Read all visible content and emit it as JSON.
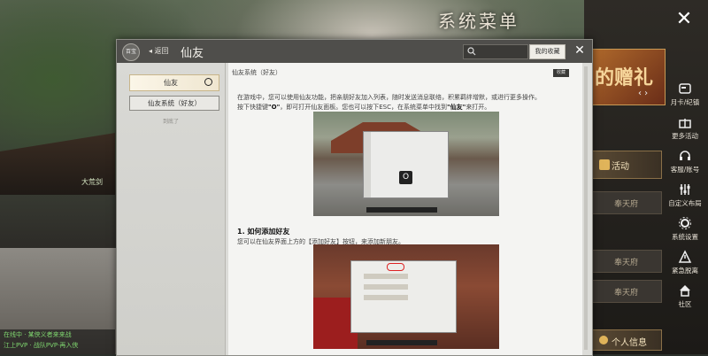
{
  "system_menu": {
    "title": "系统菜单",
    "close": "✕"
  },
  "banner": {
    "text": "的赠礼",
    "nav": "‹ ›"
  },
  "side_buttons": {
    "activity": "活动",
    "slot1": "奉天府",
    "slot2": "奉天府",
    "slot3": "奉天府",
    "personal": "个人信息"
  },
  "right_menu": [
    {
      "label": "月卡/纪镇"
    },
    {
      "label": "更多活动"
    },
    {
      "label": "客服/账号"
    },
    {
      "label": "自定义布局"
    },
    {
      "label": "系统设置"
    },
    {
      "label": "紧急脱离"
    },
    {
      "label": "社区"
    }
  ],
  "background": {
    "sign": "大荒剑",
    "chat_lines": [
      "在线中 · 某侠义者来来战",
      "江上PVP · 战队PVP·再入侠"
    ]
  },
  "panel": {
    "header": {
      "badge": "百宝",
      "back": "◂ 返回",
      "title": "仙友",
      "fav": "我的收藏",
      "close": "✕"
    },
    "left": {
      "selected": "仙友",
      "sub": "仙友系统（好友）",
      "footer": "到底了"
    },
    "content": {
      "tag": "仙友系统（好友）",
      "corner": "收藏",
      "p1": "在游戏中，您可以使用仙友功能，把亲朋好友加入列表，随时发送消息联络，积累羁绊增默，或进行更多操作。",
      "p2_pre": "按下快捷键",
      "p2_key": "\"O\"",
      "p2_mid": "，即可打开仙友面板。您也可以按下ESC，在系统菜单中找到",
      "p2_target": "\"仙友\"",
      "p2_post": "来打开。",
      "shot1_btn": "O",
      "h1": "1. 如何添加好友",
      "p3": "您可以在仙友界面上方的【添加好友】按钮，来添加新朋友。"
    }
  }
}
